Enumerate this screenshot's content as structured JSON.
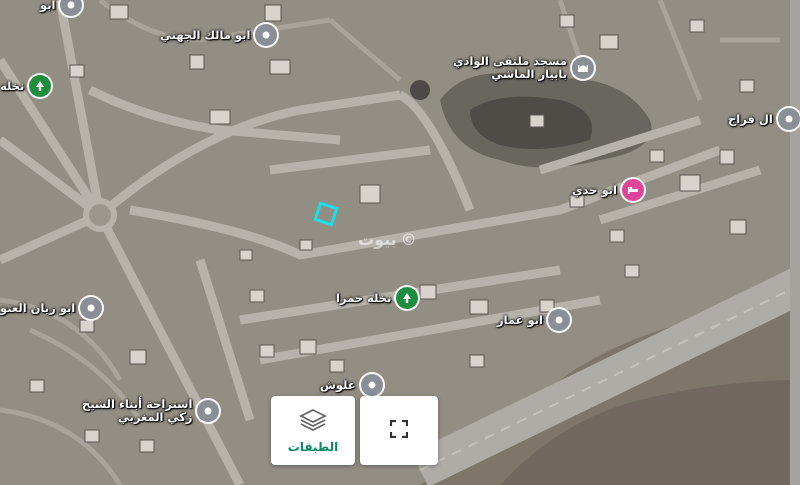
{
  "map": {
    "background": "#8f8a80",
    "road_color": "#b9b6ae",
    "highway_color": "#a9a8a2",
    "dark_area_color": "#4a4843"
  },
  "pois": [
    {
      "id": "abu-malik",
      "label": "ابو مالك الجهني",
      "icon": "place-icon",
      "color": "#8a8f96"
    },
    {
      "id": "masjid",
      "label": "مسجد ملتقى الوادي\nبابيار الماشي",
      "icon": "mosque-icon",
      "color": "#8a8f96"
    },
    {
      "id": "nakhla-left",
      "label": "نخله",
      "icon": "tree-icon",
      "color": "#1e8e3e"
    },
    {
      "id": "al-faraj",
      "label": "ال فراج",
      "icon": "place-icon",
      "color": "#8a8f96"
    },
    {
      "id": "abu-hadi",
      "label": "ابو حدي",
      "icon": "bed-icon",
      "color": "#e0439a"
    },
    {
      "id": "abu-rayan",
      "label": "ابو ريان العتو",
      "icon": "place-icon",
      "color": "#8a8f96"
    },
    {
      "id": "nakhla-hamra",
      "label": "نخله حمرا",
      "icon": "tree-icon",
      "color": "#1e8e3e"
    },
    {
      "id": "abu-ammar",
      "label": "ابو عمار",
      "icon": "place-icon",
      "color": "#8a8f96"
    },
    {
      "id": "allush",
      "label": "علوش",
      "icon": "place-icon",
      "color": "#8a8f96"
    },
    {
      "id": "istiraha",
      "label": "استراحة أبناء الشيخ\nزكي المغربي",
      "icon": "place-icon",
      "color": "#8a8f96"
    },
    {
      "id": "top-left",
      "label": "ابو",
      "icon": "place-icon",
      "color": "#8a8f96"
    }
  ],
  "watermark": {
    "text": "بيوت",
    "icon": "copyright-icon"
  },
  "parcel_marker": {
    "color": "#18e0e8"
  },
  "controls": {
    "layers_label": "الطبقات",
    "layers_icon": "layers-icon",
    "fullscreen_icon": "fullscreen-icon",
    "accent": "#0b8a66"
  }
}
